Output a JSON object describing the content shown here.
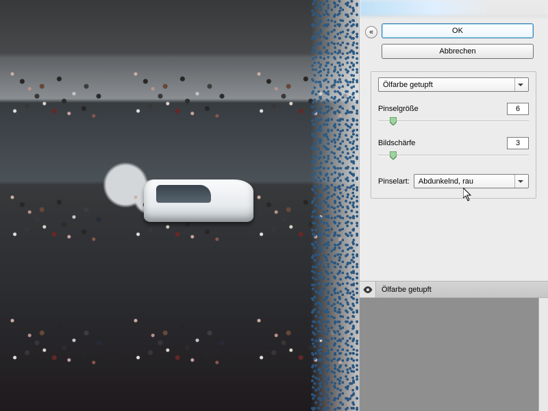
{
  "buttons": {
    "ok": "OK",
    "cancel": "Abbrechen"
  },
  "filter": {
    "name": "Ölfarbe getupft",
    "params": {
      "brush_size": {
        "label": "Pinselgröße",
        "value": "6",
        "pos_pct": 10
      },
      "sharpness": {
        "label": "Bildschärfe",
        "value": "3",
        "pos_pct": 10
      }
    },
    "brush_type": {
      "label": "Pinselart:",
      "value": "Abdunkelnd, rau"
    }
  },
  "layers": {
    "active": "Ölfarbe getupft"
  },
  "icons": {
    "collapse": "«"
  }
}
